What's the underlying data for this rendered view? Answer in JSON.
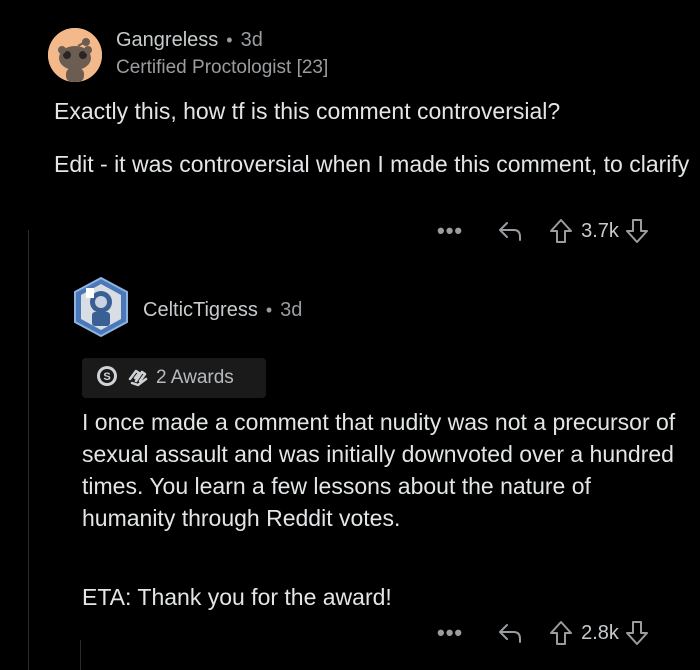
{
  "comment1": {
    "username": "Gangreless",
    "age": "3d",
    "flair": "Certified Proctologist [23]",
    "body": [
      "Exactly this, how tf is this comment controversial?",
      "Edit - it was controversial when I made this comment, to clarify"
    ],
    "more": "•••",
    "score": "3.7k"
  },
  "comment2": {
    "username": "CelticTigress",
    "age": "3d",
    "awards_label": "2 Awards",
    "body": [
      "I once made a comment that nudity was not a precursor of sexual assault and was initially downvoted over a hundred times. You learn a few lessons about the nature of humanity through Reddit votes.",
      "ETA: Thank you for the award!"
    ],
    "more": "•••",
    "score": "2.8k"
  },
  "separator": "•"
}
